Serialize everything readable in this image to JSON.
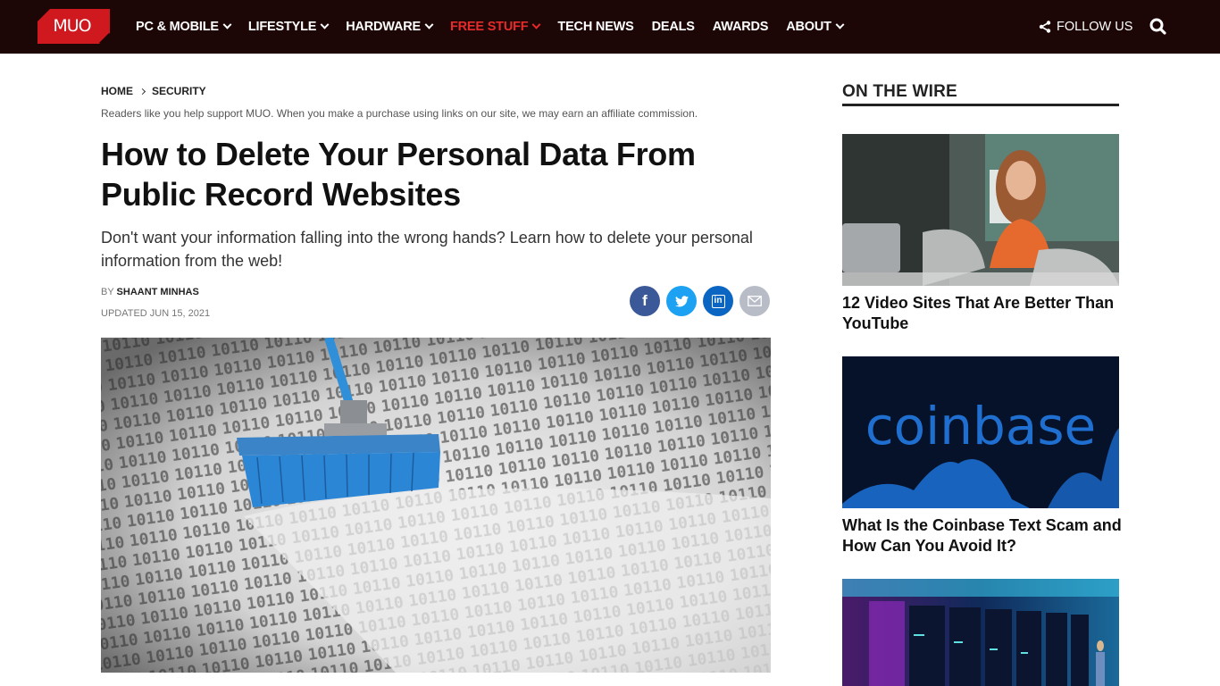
{
  "header": {
    "logo_text": "MUO",
    "nav": [
      {
        "label": "PC & MOBILE",
        "dropdown": true,
        "active": false
      },
      {
        "label": "LIFESTYLE",
        "dropdown": true,
        "active": false
      },
      {
        "label": "HARDWARE",
        "dropdown": true,
        "active": false
      },
      {
        "label": "FREE STUFF",
        "dropdown": true,
        "active": true
      },
      {
        "label": "TECH NEWS",
        "dropdown": false,
        "active": false
      },
      {
        "label": "DEALS",
        "dropdown": false,
        "active": false
      },
      {
        "label": "AWARDS",
        "dropdown": false,
        "active": false
      },
      {
        "label": "ABOUT",
        "dropdown": true,
        "active": false
      }
    ],
    "follow_label": "FOLLOW US",
    "icons": {
      "follow": "share-icon",
      "search": "search-icon"
    }
  },
  "colors": {
    "topbar": "#1d0606",
    "brand_red": "#d0181f",
    "active_nav": "#e52b2b",
    "facebook": "#3b5998",
    "twitter": "#1da1f2",
    "linkedin": "#0a66c2",
    "email": "#b7bcc6"
  },
  "article": {
    "breadcrumb": [
      "HOME",
      "SECURITY"
    ],
    "affiliate_note": "Readers like you help support MUO. When you make a purchase using links on our site, we may earn an affiliate commission.",
    "title": "How to Delete Your Personal Data From Public Record Websites",
    "subtitle": "Don't want your information falling into the wrong hands? Learn how to delete your personal information from the web!",
    "by_prefix": "BY",
    "author": "SHAANT MINHAS",
    "updated": "UPDATED JUN 15, 2021",
    "share": [
      {
        "network": "facebook",
        "icon": "facebook-icon",
        "glyph": "f"
      },
      {
        "network": "twitter",
        "icon": "twitter-icon"
      },
      {
        "network": "linkedin",
        "icon": "linkedin-icon",
        "glyph": "in"
      },
      {
        "network": "email",
        "icon": "email-icon"
      }
    ],
    "hero_alt": "Broom sweeping binary code"
  },
  "sidebar": {
    "heading": "ON THE WIRE",
    "cards": [
      {
        "title": "12 Video Sites That Are Better Than YouTube",
        "image": "woman-with-laptop"
      },
      {
        "title": "What Is the Coinbase Text Scam and How Can You Avoid It?",
        "image": "coinbase-logo",
        "image_text": "coinbase"
      },
      {
        "title": "",
        "image": "server-room"
      }
    ]
  }
}
